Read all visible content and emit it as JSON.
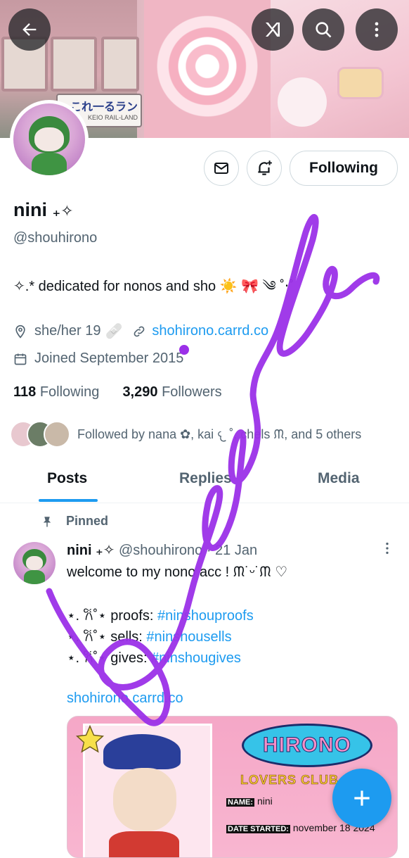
{
  "profile": {
    "name": "nini",
    "name_suffix": "₊✧",
    "handle": "@shouhirono",
    "bio": "✧.* dedicated for nonos and sho ☀️ 🎀 ༄ ˚‧˚",
    "pronouns": "she/her 19",
    "link": "shohirono.carrd.co",
    "joined": "Joined September 2015",
    "following_count": "118",
    "following_label": "Following",
    "followers_count": "3,290",
    "followers_label": "Followers",
    "followed_by": "Followed by nana ✿, kai 𐔌 ˚, chels ᙏ, and 5 others"
  },
  "actions": {
    "follow_button": "Following"
  },
  "tabs": [
    {
      "label": "Posts",
      "active": true
    },
    {
      "label": "Replies",
      "active": false
    },
    {
      "label": "Media",
      "active": false
    }
  ],
  "post": {
    "pinned_label": "Pinned",
    "author": "nini ₊✧",
    "handle": "@shouhirono",
    "date": "· 21 Jan",
    "line1": "welcome to my nono acc ! ᙏ˙ᵕ˙ᙏ ♡",
    "items": [
      {
        "prefix": "⋆. 𐙚˚⋆",
        "label": "proofs: ",
        "tag": "#ninshouproofs"
      },
      {
        "prefix": "⋆. 𐙚˚⋆",
        "label": "sells: ",
        "tag": "#ninshousells"
      },
      {
        "prefix": "⋆. 𐙚˚⋆",
        "label": "gives: ",
        "tag": "#ninshougives"
      }
    ],
    "link": "shohirono.carrd.co",
    "card": {
      "title": "HIRONO",
      "subtitle": "LOVERS CLUB",
      "name_label": "NAME:",
      "name_value": "nini",
      "date_label": "DATE STARTED:",
      "date_value": "november 18 2024"
    }
  },
  "banner_sign": "これ一るラン",
  "banner_sign_sub": "KEIO RAIL-LAND",
  "colors": {
    "accent": "#1d9bf0",
    "scribble": "#9b30e8"
  }
}
